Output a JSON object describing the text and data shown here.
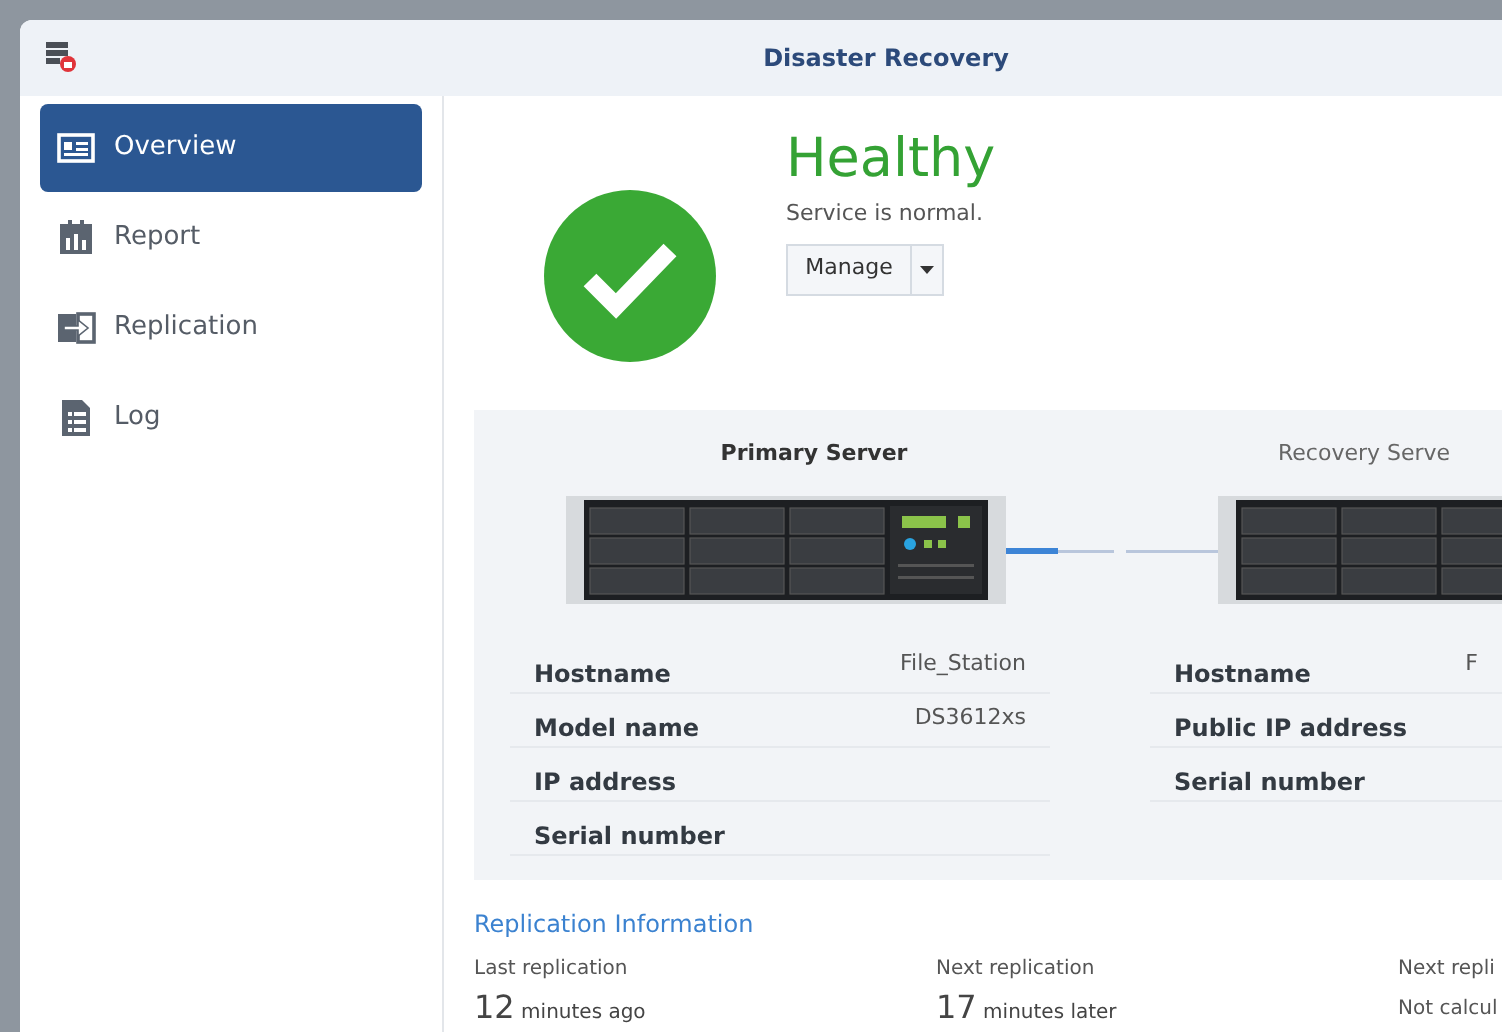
{
  "window": {
    "title": "Disaster Recovery"
  },
  "sidebar": {
    "items": [
      {
        "label": "Overview",
        "kind": "overview",
        "selected": true
      },
      {
        "label": "Report",
        "kind": "report",
        "selected": false
      },
      {
        "label": "Replication",
        "kind": "replication",
        "selected": false
      },
      {
        "label": "Log",
        "kind": "log",
        "selected": false
      }
    ]
  },
  "status": {
    "title": "Healthy",
    "message": "Service is normal.",
    "button": "Manage"
  },
  "servers": [
    {
      "title": "Primary Server",
      "emphasis": true,
      "rows": [
        {
          "label": "Hostname",
          "value": "File_Station"
        },
        {
          "label": "Model name",
          "value": "DS3612xs"
        },
        {
          "label": "IP address"
        },
        {
          "label": "Serial number"
        }
      ]
    },
    {
      "title": "Recovery Serve",
      "emphasis": false,
      "rows": [
        {
          "label": "Hostname",
          "value": "F"
        },
        {
          "label": "Public IP address"
        },
        {
          "label": "Serial number"
        }
      ]
    }
  ],
  "replication_info": {
    "title": "Replication Information",
    "items": [
      {
        "label": "Last replication",
        "number": "12",
        "unit": "minutes ago"
      },
      {
        "label": "Next replication",
        "number": "17",
        "unit": "minutes later"
      },
      {
        "label": "Next repli",
        "text": "Not calcul"
      }
    ]
  }
}
